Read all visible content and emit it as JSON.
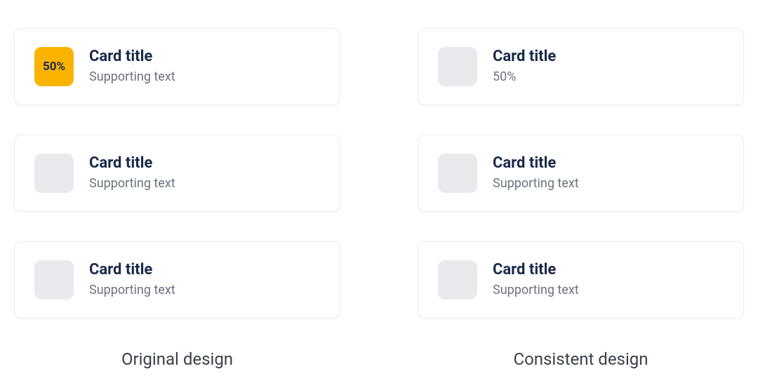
{
  "colors": {
    "accent": "#f9b300",
    "title": "#1b2a4a",
    "muted": "#6b7280",
    "placeholder": "#e8eaed"
  },
  "left": {
    "label": "Original design",
    "cards": [
      {
        "badge": "50%",
        "title": "Card title",
        "subtitle": "Supporting text"
      },
      {
        "title": "Card title",
        "subtitle": "Supporting text"
      },
      {
        "title": "Card title",
        "subtitle": "Supporting text"
      }
    ]
  },
  "right": {
    "label": "Consistent design",
    "cards": [
      {
        "title": "Card title",
        "subtitle": "50%"
      },
      {
        "title": "Card title",
        "subtitle": "Supporting text"
      },
      {
        "title": "Card title",
        "subtitle": "Supporting text"
      }
    ]
  }
}
